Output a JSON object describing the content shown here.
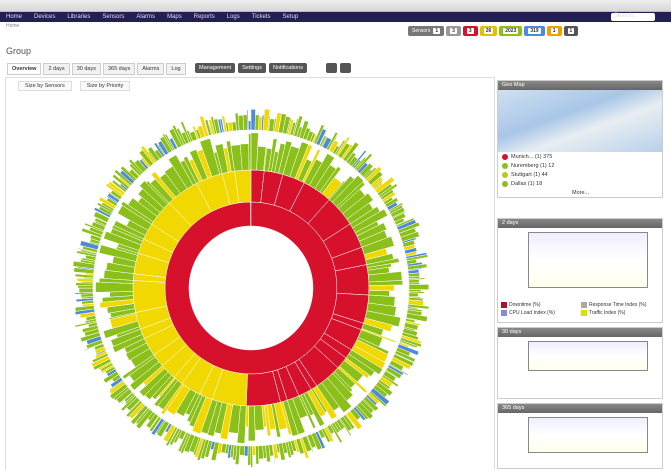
{
  "nav": [
    "Home",
    "Devices",
    "Libraries",
    "Sensors",
    "Alarms",
    "Maps",
    "Reports",
    "Logs",
    "Tickets",
    "Setup"
  ],
  "search_placeholder": "Search...",
  "breadcrumb": "Home",
  "badges": [
    {
      "label": "Sensors",
      "value": "1",
      "color": "#777"
    },
    {
      "label": "",
      "value": "3",
      "color": "#999"
    },
    {
      "label": "",
      "value": "3",
      "color": "#d7102b"
    },
    {
      "label": "",
      "value": "26",
      "color": "#e0c000"
    },
    {
      "label": "",
      "value": "2023",
      "color": "#8bbf1a"
    },
    {
      "label": "",
      "value": "319",
      "color": "#4e8ad8"
    },
    {
      "label": "",
      "value": "1",
      "color": "#f0a000"
    },
    {
      "label": "",
      "value": "1",
      "color": "#555"
    }
  ],
  "page_title": "Group",
  "tabs": [
    "Overview",
    "2 days",
    "30 days",
    "365 days",
    "Alarms",
    "Log"
  ],
  "buttons": [
    "Management",
    "Settings",
    "Notifications"
  ],
  "size_options": [
    "Size by Sensors",
    "Size by Priority"
  ],
  "geo": {
    "title": "Geo Map",
    "items": [
      {
        "label": "Munich... (1) 375",
        "color": "#d7102b"
      },
      {
        "label": "Nuremberg (1) 12",
        "color": "#8bbf1a"
      },
      {
        "label": "Stuttgart (1) 44",
        "color": "#b9c81a"
      },
      {
        "label": "Dallas (1) 18",
        "color": "#8bbf1a"
      }
    ],
    "more": "More..."
  },
  "graphs": [
    {
      "title": "2 days"
    },
    {
      "title": "30 days"
    },
    {
      "title": "365 days"
    }
  ],
  "legend": [
    {
      "label": "Downtime (%)",
      "color": "#b0102b"
    },
    {
      "label": "Response Time Index (%)",
      "color": "#aaa"
    },
    {
      "label": "CPU Load Index (%)",
      "color": "#8888dd"
    },
    {
      "label": "Traffic Index (%)",
      "color": "#e0e000"
    }
  ],
  "colors": {
    "red": "#d7102b",
    "yellow": "#f0d800",
    "green": "#8bbf1a",
    "blue": "#4e8ad8"
  }
}
